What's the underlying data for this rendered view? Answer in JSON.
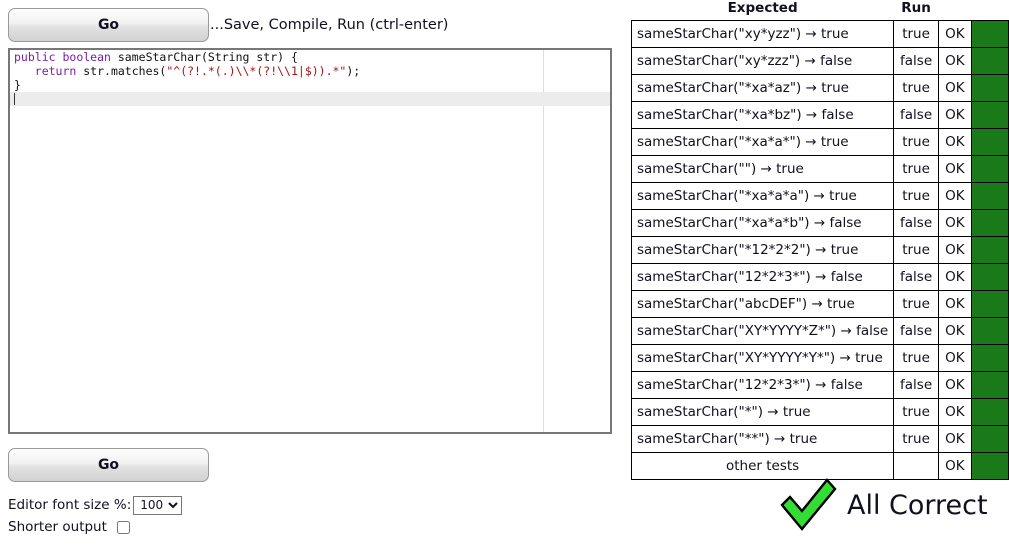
{
  "toolbar": {
    "go_label": "Go",
    "hint": "...Save, Compile, Run (ctrl-enter)"
  },
  "editor": {
    "lines": [
      {
        "tokens": [
          {
            "t": "kw",
            "v": "public"
          },
          {
            "t": "plain",
            "v": " "
          },
          {
            "t": "kw",
            "v": "boolean"
          },
          {
            "t": "plain",
            "v": " sameStarChar(String str) {"
          }
        ],
        "active": false
      },
      {
        "tokens": [
          {
            "t": "plain",
            "v": "   "
          },
          {
            "t": "kw",
            "v": "return"
          },
          {
            "t": "plain",
            "v": " str.matches("
          },
          {
            "t": "str",
            "v": "\"^(?!.*(.)\\\\*(?!\\\\1|$)).*\""
          },
          {
            "t": "plain",
            "v": ");"
          }
        ],
        "active": false
      },
      {
        "tokens": [
          {
            "t": "plain",
            "v": "}"
          }
        ],
        "active": false
      },
      {
        "tokens": [],
        "active": true
      }
    ],
    "ruler_column_note": ""
  },
  "controls": {
    "font_size_label": "Editor font size %:",
    "font_size_value": "100",
    "font_size_options": [
      "100"
    ],
    "shorter_output_label": "Shorter output",
    "shorter_output_checked": false,
    "go_label": "Go"
  },
  "results": {
    "headers": {
      "expected": "Expected",
      "run": "Run"
    },
    "rows": [
      {
        "expected": "sameStarChar(\"xy*yzz\") → true",
        "run": "true",
        "status": "OK",
        "pass": true,
        "centered": false
      },
      {
        "expected": "sameStarChar(\"xy*zzz\") → false",
        "run": "false",
        "status": "OK",
        "pass": true,
        "centered": false
      },
      {
        "expected": "sameStarChar(\"*xa*az\") → true",
        "run": "true",
        "status": "OK",
        "pass": true,
        "centered": false
      },
      {
        "expected": "sameStarChar(\"*xa*bz\") → false",
        "run": "false",
        "status": "OK",
        "pass": true,
        "centered": false
      },
      {
        "expected": "sameStarChar(\"*xa*a*\") → true",
        "run": "true",
        "status": "OK",
        "pass": true,
        "centered": false
      },
      {
        "expected": "sameStarChar(\"\") → true",
        "run": "true",
        "status": "OK",
        "pass": true,
        "centered": false
      },
      {
        "expected": "sameStarChar(\"*xa*a*a\") → true",
        "run": "true",
        "status": "OK",
        "pass": true,
        "centered": false
      },
      {
        "expected": "sameStarChar(\"*xa*a*b\") → false",
        "run": "false",
        "status": "OK",
        "pass": true,
        "centered": false
      },
      {
        "expected": "sameStarChar(\"*12*2*2\") → true",
        "run": "true",
        "status": "OK",
        "pass": true,
        "centered": false
      },
      {
        "expected": "sameStarChar(\"12*2*3*\") → false",
        "run": "false",
        "status": "OK",
        "pass": true,
        "centered": false
      },
      {
        "expected": "sameStarChar(\"abcDEF\") → true",
        "run": "true",
        "status": "OK",
        "pass": true,
        "centered": false
      },
      {
        "expected": "sameStarChar(\"XY*YYYY*Z*\") → false",
        "run": "false",
        "status": "OK",
        "pass": true,
        "centered": false
      },
      {
        "expected": "sameStarChar(\"XY*YYYY*Y*\") → true",
        "run": "true",
        "status": "OK",
        "pass": true,
        "centered": false
      },
      {
        "expected": "sameStarChar(\"12*2*3*\") → false",
        "run": "false",
        "status": "OK",
        "pass": true,
        "centered": false
      },
      {
        "expected": "sameStarChar(\"*\") → true",
        "run": "true",
        "status": "OK",
        "pass": true,
        "centered": false
      },
      {
        "expected": "sameStarChar(\"**\") → true",
        "run": "true",
        "status": "OK",
        "pass": true,
        "centered": false
      },
      {
        "expected": "other tests",
        "run": "",
        "status": "OK",
        "pass": true,
        "centered": true
      }
    ],
    "pass_color": "#1a7a1a"
  },
  "summary": {
    "label": "All Correct",
    "check_color": "#33dd33",
    "icon": "check-mark-icon"
  }
}
